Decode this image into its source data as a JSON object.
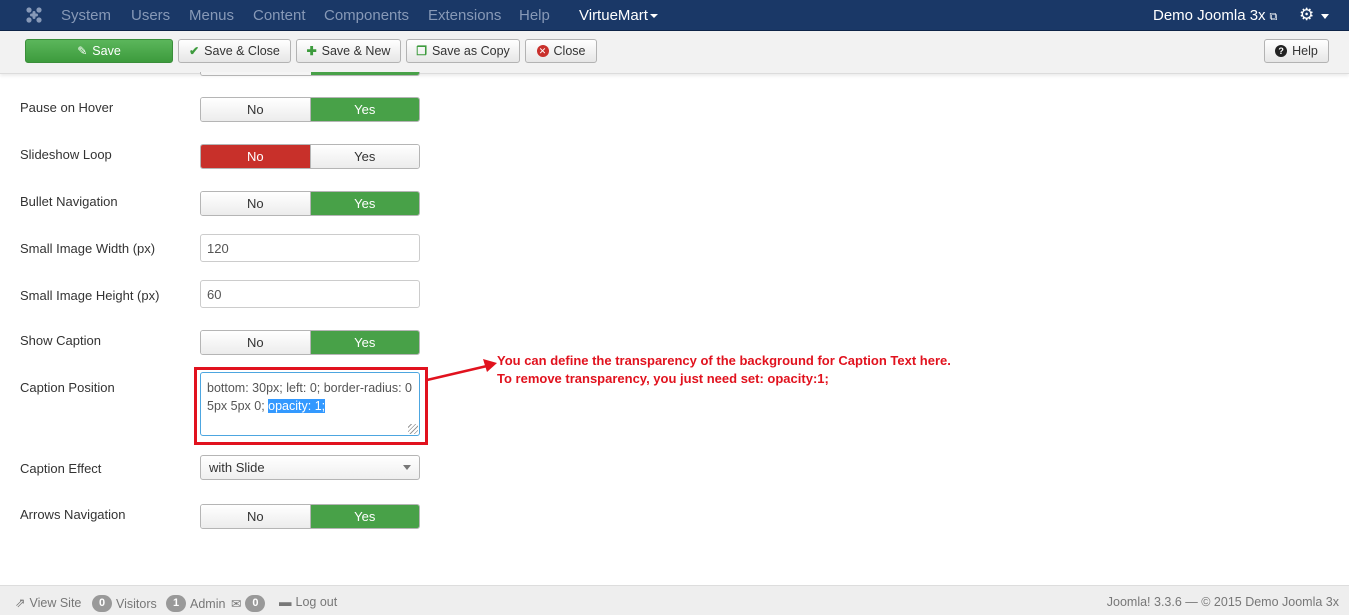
{
  "topnav": {
    "menu": [
      "System",
      "Users",
      "Menus",
      "Content",
      "Components",
      "Extensions",
      "Help"
    ],
    "virtuemart_label": "VirtueMart",
    "site_label": "Demo Joomla 3x",
    "logo_icon": "joomla-logo-icon",
    "ext_icon": "external-link-icon",
    "gear_icon": "gear-icon"
  },
  "toolbar": {
    "save": "Save",
    "save_close": "Save & Close",
    "save_new": "Save & New",
    "save_copy": "Save as Copy",
    "close": "Close",
    "help": "Help"
  },
  "form": {
    "pause_on_hover": {
      "label": "Pause on Hover",
      "no": "No",
      "yes": "Yes",
      "value": "Yes"
    },
    "slideshow_loop": {
      "label": "Slideshow Loop",
      "no": "No",
      "yes": "Yes",
      "value": "No"
    },
    "bullet_navigation": {
      "label": "Bullet Navigation",
      "no": "No",
      "yes": "Yes",
      "value": "Yes"
    },
    "small_image_width": {
      "label": "Small Image Width (px)",
      "value": "120"
    },
    "small_image_height": {
      "label": "Small Image Height (px)",
      "value": "60"
    },
    "show_caption": {
      "label": "Show Caption",
      "no": "No",
      "yes": "Yes",
      "value": "Yes"
    },
    "caption_position": {
      "label": "Caption Position",
      "value_plain": "bottom: 30px; left: 0; border-radius: 0 5px 5px 0; ",
      "value_selected": "opacity: 1;"
    },
    "caption_effect": {
      "label": "Caption Effect",
      "value": "with Slide"
    },
    "arrows_navigation": {
      "label": "Arrows Navigation",
      "no": "No",
      "yes": "Yes",
      "value": "Yes"
    }
  },
  "annotation": {
    "line1": "You can define the transparency of the background for Caption Text here.",
    "line2": "To remove transparency, you just need set: opacity:1;"
  },
  "footer": {
    "view_site": "View Site",
    "visitors_count": "0",
    "visitors_label": "Visitors",
    "admin_count": "1",
    "admin_label": "Admin",
    "messages_count": "0",
    "logout": "Log out",
    "copyright": "Joomla! 3.3.6 — © 2015 Demo Joomla 3x"
  },
  "colors": {
    "nav_bg": "#1a3867",
    "yes_active": "#48a148",
    "no_active": "#c8302a",
    "annotation": "#e1121e"
  }
}
